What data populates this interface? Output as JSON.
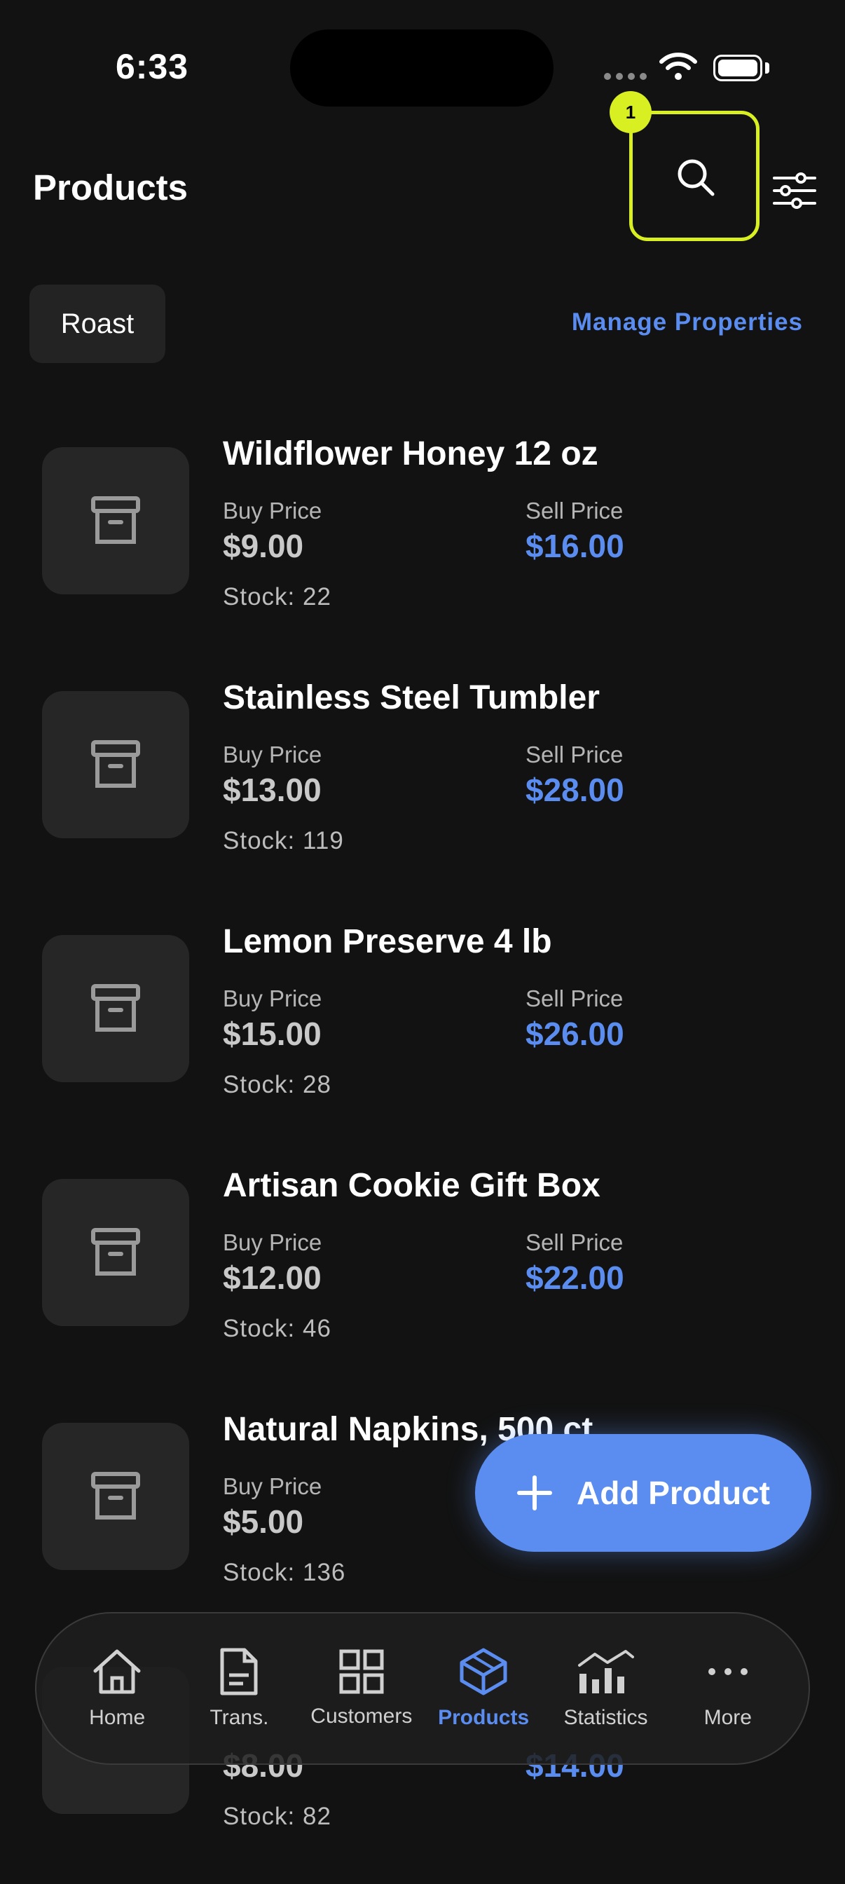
{
  "status_bar": {
    "time": "6:33"
  },
  "header": {
    "title": "Products",
    "highlight_badge": "1"
  },
  "filters": {
    "chip_label": "Roast",
    "manage_label": "Manage Properties"
  },
  "products": [
    {
      "name": "Wildflower Honey 12 oz",
      "buy_label": "Buy Price",
      "buy_price": "$9.00",
      "sell_label": "Sell Price",
      "sell_price": "$16.00",
      "stock": "Stock: 22"
    },
    {
      "name": "Stainless Steel Tumbler",
      "buy_label": "Buy Price",
      "buy_price": "$13.00",
      "sell_label": "Sell Price",
      "sell_price": "$28.00",
      "stock": "Stock: 119"
    },
    {
      "name": "Lemon Preserve 4 lb",
      "buy_label": "Buy Price",
      "buy_price": "$15.00",
      "sell_label": "Sell Price",
      "sell_price": "$26.00",
      "stock": "Stock: 28"
    },
    {
      "name": "Artisan Cookie Gift Box",
      "buy_label": "Buy Price",
      "buy_price": "$12.00",
      "sell_label": "Sell Price",
      "sell_price": "$22.00",
      "stock": "Stock: 46"
    },
    {
      "name": "Natural Napkins, 500 ct",
      "buy_label": "Buy Price",
      "buy_price": "$5.00",
      "sell_label": "",
      "sell_price": "",
      "stock": "Stock: 136"
    },
    {
      "name": "",
      "buy_label": "",
      "buy_price": "$8.00",
      "sell_label": "",
      "sell_price": "$14.00",
      "stock": "Stock: 82"
    }
  ],
  "fab": {
    "label": "Add Product"
  },
  "nav": {
    "items": [
      {
        "label": "Home",
        "icon": "home-icon"
      },
      {
        "label": "Trans.",
        "icon": "document-icon"
      },
      {
        "label": "Customers",
        "icon": "grid-icon"
      },
      {
        "label": "Products",
        "icon": "cube-icon"
      },
      {
        "label": "Statistics",
        "icon": "chart-icon"
      },
      {
        "label": "More",
        "icon": "more-icon"
      }
    ],
    "active": "Products"
  },
  "colors": {
    "background": "#121212",
    "accent": "#5b8df0",
    "highlight": "#d8f021"
  }
}
